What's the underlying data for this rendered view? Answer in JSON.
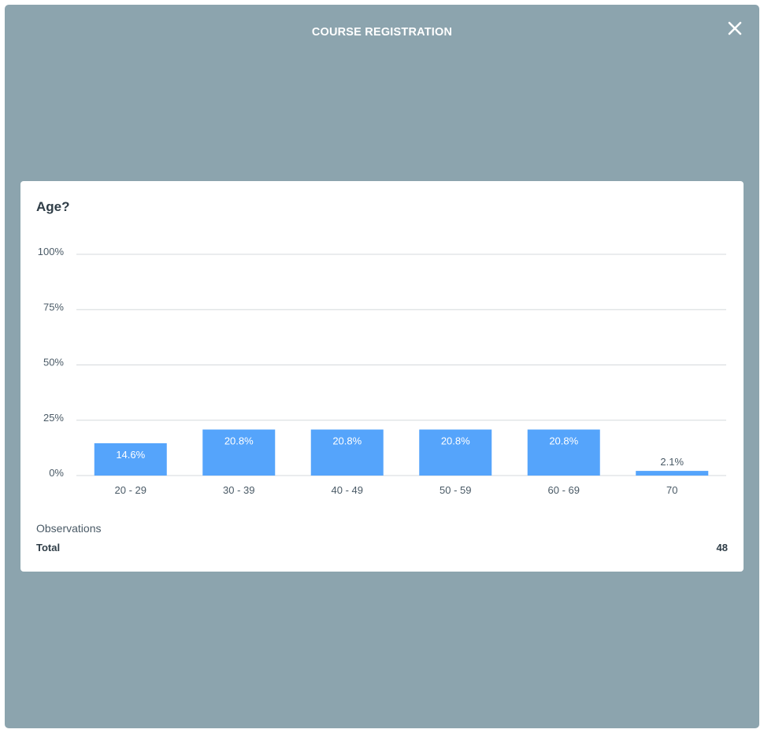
{
  "modal": {
    "title": "COURSE REGISTRATION",
    "close_icon": "close-icon",
    "background": "#8ca4ae"
  },
  "card": {
    "question": "Age?",
    "observations_label": "Observations",
    "total_label": "Total",
    "total_value": "48"
  },
  "chart_data": {
    "type": "bar",
    "title": "Age?",
    "categories": [
      "20 - 29",
      "30 - 39",
      "40 - 49",
      "50 - 59",
      "60 - 69",
      "70"
    ],
    "values": [
      14.6,
      20.8,
      20.8,
      20.8,
      20.8,
      2.1
    ],
    "labels": [
      "14.6%",
      "20.8%",
      "20.8%",
      "20.8%",
      "20.8%",
      "2.1%"
    ],
    "yticks": [
      "0%",
      "25%",
      "50%",
      "75%",
      "100%"
    ],
    "ylim": [
      0,
      100
    ],
    "grid": true,
    "bar_color": "#55a4fb"
  }
}
